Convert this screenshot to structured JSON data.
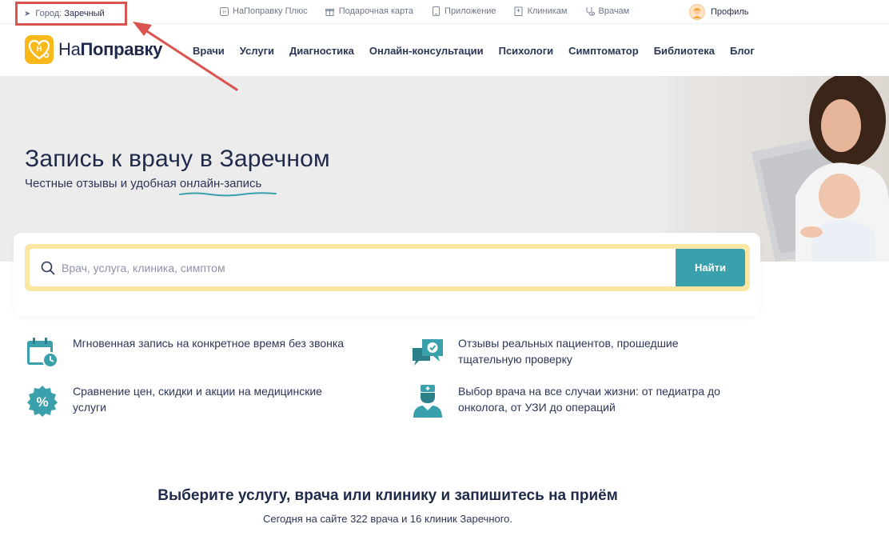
{
  "topbar": {
    "city_label": "Город:",
    "city_name": "Заречный",
    "links": [
      {
        "icon": "plus-card-icon",
        "label": "НаПоправку Плюс"
      },
      {
        "icon": "gift-icon",
        "label": "Подарочная карта"
      },
      {
        "icon": "phone-icon",
        "label": "Приложение"
      },
      {
        "icon": "building-icon",
        "label": "Клиникам"
      },
      {
        "icon": "stethoscope-icon",
        "label": "Врачам"
      }
    ],
    "profile_label": "Профиль"
  },
  "header": {
    "logo_light": "На",
    "logo_bold": "Поправку",
    "nav": [
      "Врачи",
      "Услуги",
      "Диагностика",
      "Онлайн-консультации",
      "Психологи",
      "Симптоматор",
      "Библиотека",
      "Блог"
    ]
  },
  "hero": {
    "title": "Запись к врачу в Заречном",
    "subtitle_prefix": "Честные отзывы и удобная",
    "subtitle_highlight": "онлайн-запись"
  },
  "search": {
    "placeholder": "Врач, услуга, клиника, симптом",
    "button_label": "Найти"
  },
  "features": [
    {
      "icon": "calendar-clock-icon",
      "text": "Мгновенная запись на конкретное время без звонка"
    },
    {
      "icon": "review-check-icon",
      "text": "Отзывы реальных пациентов, прошедшие тщательную проверку"
    },
    {
      "icon": "percent-badge-icon",
      "text": "Сравнение цен, скидки и акции на медицинские услуги"
    },
    {
      "icon": "doctor-icon",
      "text": "Выбор врача на все случаи жизни: от педиатра до онколога, от УЗИ до операций"
    }
  ],
  "bottom": {
    "title": "Выберите услугу, врача или клинику и запишитесь на приём",
    "subtitle": "Сегодня на сайте 322 врача и 16 клиник Заречного."
  },
  "colors": {
    "accent": "#3aa0ab",
    "logo_yellow": "#f9b81a",
    "search_frame": "#fbe7a3",
    "annotation": "#d9534f"
  }
}
